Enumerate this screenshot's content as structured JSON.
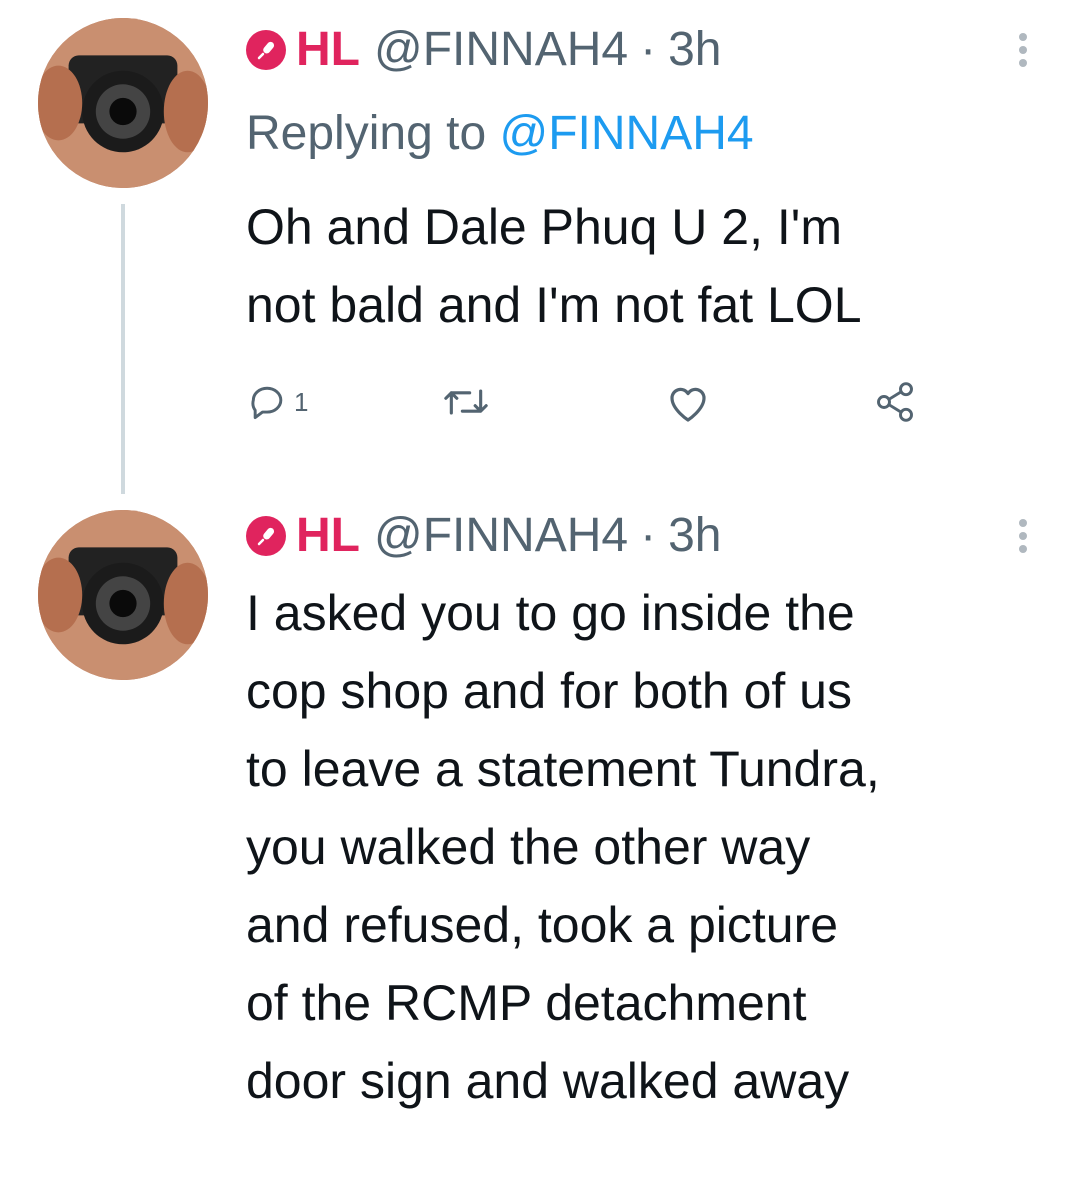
{
  "tweets": [
    {
      "name": "HL",
      "handle": "@FINNAH4",
      "separator": "·",
      "time": "3h",
      "replying_prefix": "Replying to ",
      "replying_to": "@FINNAH4",
      "text_lines": [
        "Oh and Dale Phuq U 2, I'm",
        "not bald and I'm not fat LOL"
      ],
      "reply_count": "1",
      "icons": [
        "mic-icon",
        "more-icon",
        "reply-icon",
        "retweet-icon",
        "like-icon",
        "share-icon"
      ]
    },
    {
      "name": "HL",
      "handle": "@FINNAH4",
      "separator": "·",
      "time": "3h",
      "text_lines": [
        "I asked you to go inside the",
        "cop shop and for both of us",
        "to leave a statement Tundra,",
        "you walked the other way",
        "and refused, took a picture",
        "of the RCMP detachment",
        "door sign and walked away"
      ]
    }
  ],
  "colors": {
    "name": "#e0245e",
    "link": "#1d9bf0",
    "muted": "#536471",
    "thread": "#cfd9de"
  }
}
